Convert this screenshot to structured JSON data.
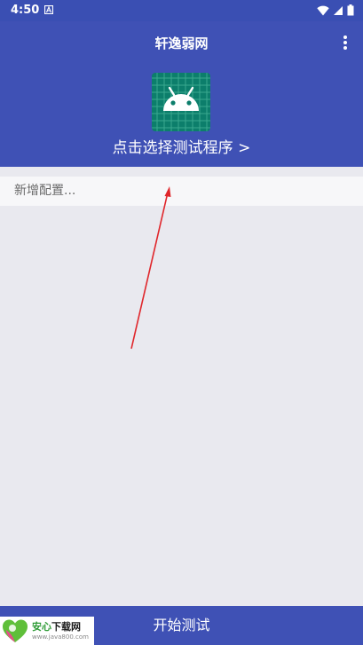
{
  "status_bar": {
    "time": "4:50",
    "notification_icon": "a-notification-icon",
    "icons": [
      "wifi-icon",
      "signal-icon",
      "battery-icon"
    ]
  },
  "header": {
    "title": "轩逸弱网",
    "menu_icon": "more-vertical-icon",
    "app_icon": "android-icon",
    "select_label": "点击选择测试程序 >"
  },
  "config": {
    "add_label": "新增配置..."
  },
  "footer": {
    "start_label": "开始测试"
  },
  "watermark": {
    "brand_part1": "安心",
    "brand_part2": "下载网",
    "url": "www.java800.com"
  },
  "colors": {
    "primary": "#3f51b5",
    "status_bar": "#3a4fb3",
    "background": "#e9e9ef",
    "annotation_arrow": "#e0262b"
  }
}
